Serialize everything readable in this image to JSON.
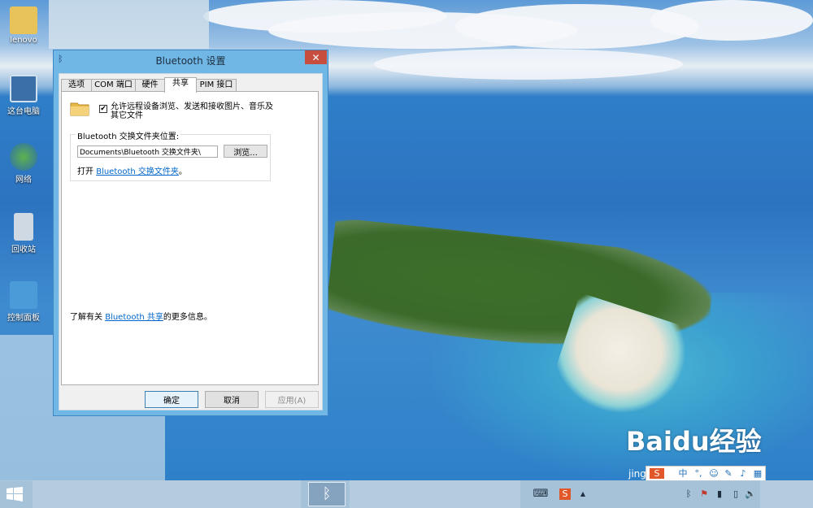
{
  "desktop": {
    "icons": [
      {
        "label": "lenovo"
      },
      {
        "label": "这台电脑"
      },
      {
        "label": "网络"
      },
      {
        "label": "回收站"
      },
      {
        "label": "控制面板"
      }
    ],
    "watermark": "Baidu经验",
    "watermark_sub": "jingyan.baidu.com"
  },
  "dialog": {
    "title": "Bluetooth 设置",
    "close_label": "✕",
    "tabs": [
      {
        "label": "选项",
        "active": false
      },
      {
        "label": "COM 端口",
        "active": false
      },
      {
        "label": "硬件",
        "active": false
      },
      {
        "label": "共享",
        "active": true
      },
      {
        "label": "PIM 接口",
        "active": false
      }
    ],
    "share": {
      "checkbox_checked": true,
      "checkbox_label": "允许远程设备浏览、发送和接收图片、音乐及其它文件",
      "group_title": "Bluetooth 交换文件夹位置:",
      "path_value": "Documents\\Bluetooth 交换文件夹\\",
      "browse_label": "浏览...",
      "open_prefix": "打开 ",
      "open_link": "Bluetooth 交换文件夹",
      "open_suffix": "。",
      "info_prefix": "了解有关 ",
      "info_link": "Bluetooth 共享",
      "info_suffix": "的更多信息。"
    },
    "buttons": {
      "ok": "确定",
      "cancel": "取消",
      "apply": "应用(A)"
    }
  },
  "taskbar": {
    "task_item_icon": "bluetooth-icon",
    "tray": [
      {
        "name": "keyboard-icon",
        "glyph": "⌨"
      },
      {
        "name": "sogou-icon",
        "glyph": "S"
      },
      {
        "name": "show-hidden-icon",
        "glyph": "▲"
      },
      {
        "name": "bluetooth-tray-icon",
        "glyph": "ᛒ"
      },
      {
        "name": "flag-icon",
        "glyph": "⚑"
      },
      {
        "name": "signal-icon",
        "glyph": "▮"
      },
      {
        "name": "battery-icon",
        "glyph": "▯"
      },
      {
        "name": "volume-icon",
        "glyph": "🔈"
      }
    ]
  },
  "ime": {
    "items": [
      {
        "name": "sogou-logo-icon",
        "glyph": "S"
      },
      {
        "name": "ime-chinese-mode",
        "glyph": "中"
      },
      {
        "name": "ime-punctuation-icon",
        "glyph": "°,"
      },
      {
        "name": "ime-emoji-icon",
        "glyph": "☺"
      },
      {
        "name": "ime-skin-icon",
        "glyph": "✎"
      },
      {
        "name": "ime-voice-icon",
        "glyph": "♪"
      },
      {
        "name": "ime-toolbox-icon",
        "glyph": "▦"
      }
    ]
  }
}
